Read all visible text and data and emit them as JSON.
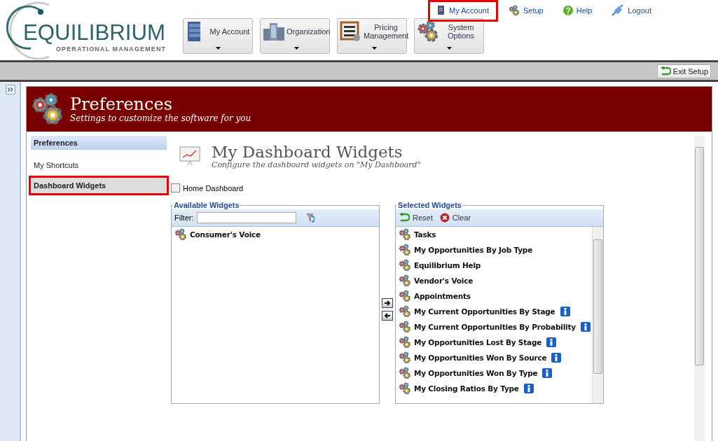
{
  "logo": {
    "name": "EQUILIBRIUM",
    "tagline": "OPERATIONAL MANAGEMENT"
  },
  "menu": [
    {
      "label": "My Account",
      "kind": "cabinet"
    },
    {
      "label": "Organization",
      "kind": "buildings"
    },
    {
      "label": "Pricing Management",
      "kind": "abacus"
    },
    {
      "label": "System Options",
      "kind": "gears"
    }
  ],
  "top_links": [
    {
      "label": "My Account",
      "kind": "account",
      "highlighted": true
    },
    {
      "label": "Setup",
      "kind": "setup",
      "highlighted": false
    },
    {
      "label": "Help",
      "kind": "help",
      "highlighted": false
    },
    {
      "label": "Logout",
      "kind": "logout",
      "highlighted": false
    }
  ],
  "toolbar": {
    "exit_button": "Exit Setup"
  },
  "banner": {
    "title": "Preferences",
    "subtitle": "Settings to customize the software for you"
  },
  "sidebar": {
    "heading": "Preferences",
    "items": [
      {
        "label": "My Shortcuts",
        "selected": false,
        "highlighted": false
      },
      {
        "label": "Dashboard Widgets",
        "selected": true,
        "highlighted": true
      }
    ]
  },
  "page": {
    "title": "My Dashboard Widgets",
    "subtitle": "Configure the dashboard widgets on \"My Dashboard\""
  },
  "home_dashboard": {
    "label": "Home Dashboard",
    "checked": false
  },
  "available": {
    "title": "Available Widgets",
    "filter_label": "Filter:",
    "items": [
      {
        "label": "Consumer's Voice",
        "info": false
      }
    ]
  },
  "selected_widgets": {
    "title": "Selected Widgets",
    "actions": [
      {
        "label": "Reset",
        "kind": "reset"
      },
      {
        "label": "Clear",
        "kind": "clear"
      }
    ],
    "items": [
      {
        "label": "Tasks",
        "info": false
      },
      {
        "label": "My Opportunities By Job Type",
        "info": false
      },
      {
        "label": "Equilibrium Help",
        "info": false
      },
      {
        "label": "Vendor's Voice",
        "info": false
      },
      {
        "label": "Appointments",
        "info": false
      },
      {
        "label": "My Current Opportunities By Stage",
        "info": true
      },
      {
        "label": "My Current Opportunities By Probability",
        "info": true
      },
      {
        "label": "My Opportunities Lost By Stage",
        "info": true
      },
      {
        "label": "My Opportunities Won By Source",
        "info": true
      },
      {
        "label": "My Opportunities Won By Type",
        "info": true
      },
      {
        "label": "My Closing Ratios By Type",
        "info": true
      }
    ]
  }
}
